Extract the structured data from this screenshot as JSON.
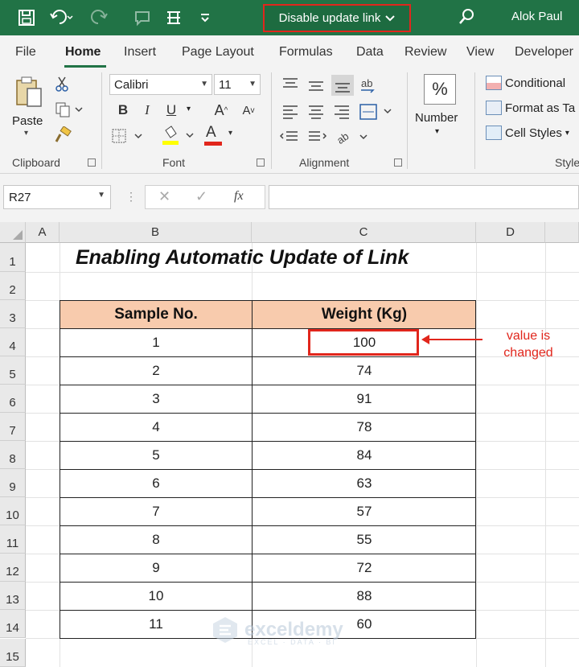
{
  "titlebar": {
    "title": "Disable update link",
    "user": "Alok Paul"
  },
  "menu": [
    "File",
    "Home",
    "Insert",
    "Page Layout",
    "Formulas",
    "Data",
    "Review",
    "View",
    "Developer"
  ],
  "ribbon": {
    "clipboard": {
      "paste": "Paste",
      "label": "Clipboard"
    },
    "font": {
      "name": "Calibri",
      "size": "11",
      "label": "Font",
      "bold": "B",
      "italic": "I",
      "underline": "U",
      "grow": "A",
      "shrink": "A",
      "color_a": "A"
    },
    "alignment": {
      "label": "Alignment"
    },
    "number": {
      "label": "Number"
    },
    "styles": {
      "conditional": "Conditional",
      "format_as": "Format as Ta",
      "cell_styles": "Cell Styles",
      "label": "Style"
    }
  },
  "formula_bar": {
    "name_box": "R27",
    "fx": "fx"
  },
  "columns": [
    "A",
    "B",
    "C",
    "D"
  ],
  "rows": [
    "1",
    "2",
    "3",
    "4",
    "5",
    "6",
    "7",
    "8",
    "9",
    "10",
    "11",
    "12",
    "13",
    "14",
    "15"
  ],
  "sheet": {
    "title": "Enabling Automatic Update of Link",
    "table": {
      "headers": [
        "Sample No.",
        "Weight (Kg)"
      ],
      "rows": [
        [
          "1",
          "100"
        ],
        [
          "2",
          "74"
        ],
        [
          "3",
          "91"
        ],
        [
          "4",
          "78"
        ],
        [
          "5",
          "84"
        ],
        [
          "6",
          "63"
        ],
        [
          "7",
          "57"
        ],
        [
          "8",
          "55"
        ],
        [
          "9",
          "72"
        ],
        [
          "10",
          "88"
        ],
        [
          "11",
          "60"
        ]
      ]
    },
    "annotation": "value is changed"
  },
  "watermark": {
    "name": "exceldemy",
    "tagline": "EXCEL · DATA · BI"
  },
  "colors": {
    "excel_green": "#217346",
    "highlight_red": "#e1261c",
    "header_fill": "#f8cbad"
  }
}
